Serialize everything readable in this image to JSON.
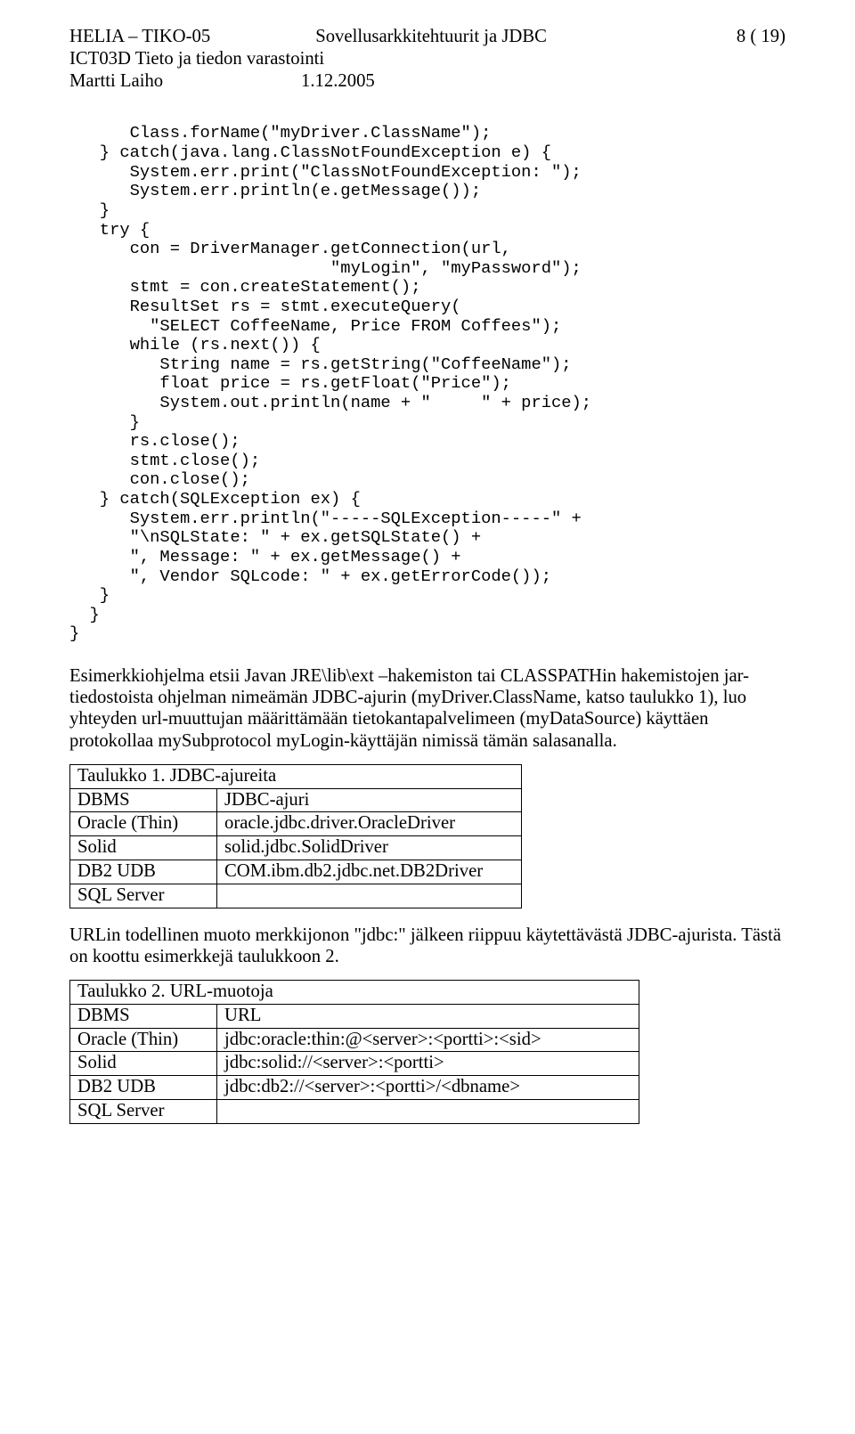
{
  "header": {
    "left": "HELIA – TIKO-05",
    "center": "Sovellusarkkitehtuurit ja JDBC",
    "right": "8 ( 19)",
    "sub1": "ICT03D  Tieto ja tiedon varastointi",
    "sub2_left": "Martti Laiho",
    "sub2_right": "1.12.2005"
  },
  "code": "      Class.forName(\"myDriver.ClassName\");\n   } catch(java.lang.ClassNotFoundException e) {\n      System.err.print(\"ClassNotFoundException: \");\n      System.err.println(e.getMessage());\n   }\n   try {\n      con = DriverManager.getConnection(url,\n                          \"myLogin\", \"myPassword\");\n      stmt = con.createStatement();\n      ResultSet rs = stmt.executeQuery(\n        \"SELECT CoffeeName, Price FROM Coffees\");\n      while (rs.next()) {\n         String name = rs.getString(\"CoffeeName\");\n         float price = rs.getFloat(\"Price\");\n         System.out.println(name + \"     \" + price);\n      }\n      rs.close();\n      stmt.close();\n      con.close();\n   } catch(SQLException ex) {\n      System.err.println(\"-----SQLException-----\" +\n      \"\\nSQLState: \" + ex.getSQLState() +\n      \", Message: \" + ex.getMessage() +\n      \", Vendor SQLcode: \" + ex.getErrorCode());\n   }\n  }\n}",
  "para1": "Esimerkkiohjelma etsii Javan JRE\\lib\\ext –hakemiston tai CLASSPATHin hakemistojen jar-tiedostoista ohjelman nimeämän JDBC-ajurin (myDriver.ClassName, katso taulukko 1), luo yhteyden url-muuttujan määrittämään tietokantapalvelimeen (myDataSource) käyttäen protokollaa mySubprotocol myLogin-käyttäjän nimissä tämän salasanalla.",
  "table1": {
    "caption": "Taulukko 1.  JDBC-ajureita",
    "rows": [
      [
        "DBMS",
        "JDBC-ajuri"
      ],
      [
        "Oracle (Thin)",
        "oracle.jdbc.driver.OracleDriver"
      ],
      [
        "Solid",
        "solid.jdbc.SolidDriver"
      ],
      [
        "DB2 UDB",
        "COM.ibm.db2.jdbc.net.DB2Driver"
      ],
      [
        "SQL Server",
        ""
      ]
    ]
  },
  "para2": "URLin todellinen muoto merkkijonon \"jdbc:\" jälkeen riippuu käytettävästä JDBC-ajurista. Tästä on koottu esimerkkejä taulukkoon 2.",
  "table2": {
    "caption": "Taulukko 2. URL-muotoja",
    "rows": [
      [
        "DBMS",
        "URL"
      ],
      [
        "Oracle (Thin)",
        "jdbc:oracle:thin:@<server>:<portti>:<sid>"
      ],
      [
        "Solid",
        "jdbc:solid://<server>:<portti>"
      ],
      [
        "DB2 UDB",
        "jdbc:db2://<server>:<portti>/<dbname>"
      ],
      [
        "SQL Server",
        ""
      ]
    ]
  }
}
